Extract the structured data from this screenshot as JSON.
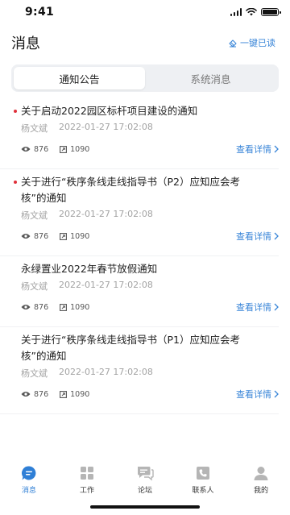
{
  "status_bar": {
    "time": "9:41"
  },
  "header": {
    "title": "消息",
    "mark_all_read": "一键已读"
  },
  "tabs": [
    {
      "label": "通知公告",
      "active": true
    },
    {
      "label": "系统消息",
      "active": false
    }
  ],
  "notices": [
    {
      "title": "关于启动2022园区标杆项目建设的通知",
      "author": "杨文斌",
      "datetime": "2022-01-27   17:02:08",
      "views": "876",
      "shares": "1090",
      "unread": true,
      "detail": "查看详情"
    },
    {
      "title": "关于进行“秩序条线走线指导书（P2）应知应会考核”的通知",
      "author": "杨文斌",
      "datetime": "2022-01-27   17:02:08",
      "views": "876",
      "shares": "1090",
      "unread": true,
      "detail": "查看详情"
    },
    {
      "title": "永绿置业2022年春节放假通知",
      "author": "杨文斌",
      "datetime": "2022-01-27   17:02:08",
      "views": "876",
      "shares": "1090",
      "unread": false,
      "detail": "查看详情"
    },
    {
      "title": "关于进行“秩序条线走线指导书（P1）应知应会考核”的通知",
      "author": "杨文斌",
      "datetime": "2022-01-27   17:02:08",
      "views": "876",
      "shares": "1090",
      "unread": false,
      "detail": "查看详情"
    }
  ],
  "bottom_nav": [
    {
      "label": "消息",
      "icon": "chat-bubble-icon",
      "active": true
    },
    {
      "label": "工作",
      "icon": "grid-apps-icon",
      "active": false
    },
    {
      "label": "论坛",
      "icon": "forum-icon",
      "active": false
    },
    {
      "label": "联系人",
      "icon": "phone-contact-icon",
      "active": false
    },
    {
      "label": "我的",
      "icon": "person-icon",
      "active": false
    }
  ],
  "colors": {
    "accent": "#3a86d8",
    "unread_dot": "#e0303a",
    "nav_active": "#2f7fd6",
    "nav_inactive": "#b5b5b5"
  }
}
